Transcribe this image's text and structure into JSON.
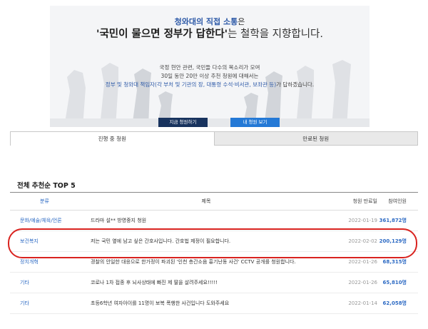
{
  "hero": {
    "line1_blue": "청와대의 직접 소통",
    "line1_plain": "은",
    "line2_quote": "'국민이 물으면 정부가 답한다'",
    "line2_rest": "는 철학을 지향합니다.",
    "desc1": "국정 현안 관련, 국민들 다수의 목소리가 모여",
    "desc2": "30일 동안 20만 이상 추천 청원에 대해서는",
    "desc3_blue": "정부 및 청와대 책임자(각 부처 및 기관의 장, 대통령 수석·비서관, 보좌관 등)",
    "desc3_plain": "가 답하겠습니다.",
    "btn_write": "지금 청원하기",
    "btn_view": "내 청원 보기"
  },
  "tabs": [
    {
      "label": "진행 중 청원"
    },
    {
      "label": "만료된 청원"
    }
  ],
  "section_title": "전체 추천순 TOP 5",
  "table": {
    "headers": {
      "category": "분류",
      "title": "제목",
      "date": "청원 만료일",
      "count": "참여인원"
    },
    "rows": [
      {
        "category": "문화/예술/체육/언론",
        "title": "드라마 설** 방영중지 청원",
        "date": "2022-01-19",
        "count": "361,872명"
      },
      {
        "category": "보건복지",
        "title": "저는 국민 옆에 남고 싶은 간호사입니다. 간호법 제정이 필요합니다.",
        "date": "2022-02-02",
        "count": "200,129명"
      },
      {
        "category": "정치개혁",
        "title": "경찰의 안일한 대응으로 한가정이 파괴된 '인천 층간소음 흉기난동 사건' CCTV 공개를 청원합니다.",
        "date": "2022-01-26",
        "count": "68,315명"
      },
      {
        "category": "기타",
        "title": "코로나 1차 접종 후 뇌사상태에 빠진 제 딸을 살려주세요!!!!!",
        "date": "2022-01-26",
        "count": "65,810명"
      },
      {
        "category": "기타",
        "title": "초등6학년 여자아이를 11명이 보복 폭행한 사건입니다 도와주세요",
        "date": "2022-01-14",
        "count": "62,058명"
      }
    ]
  },
  "colors": {
    "accent_blue": "#2e6bc4",
    "navy": "#18335e",
    "highlight_red": "#d9231f"
  }
}
